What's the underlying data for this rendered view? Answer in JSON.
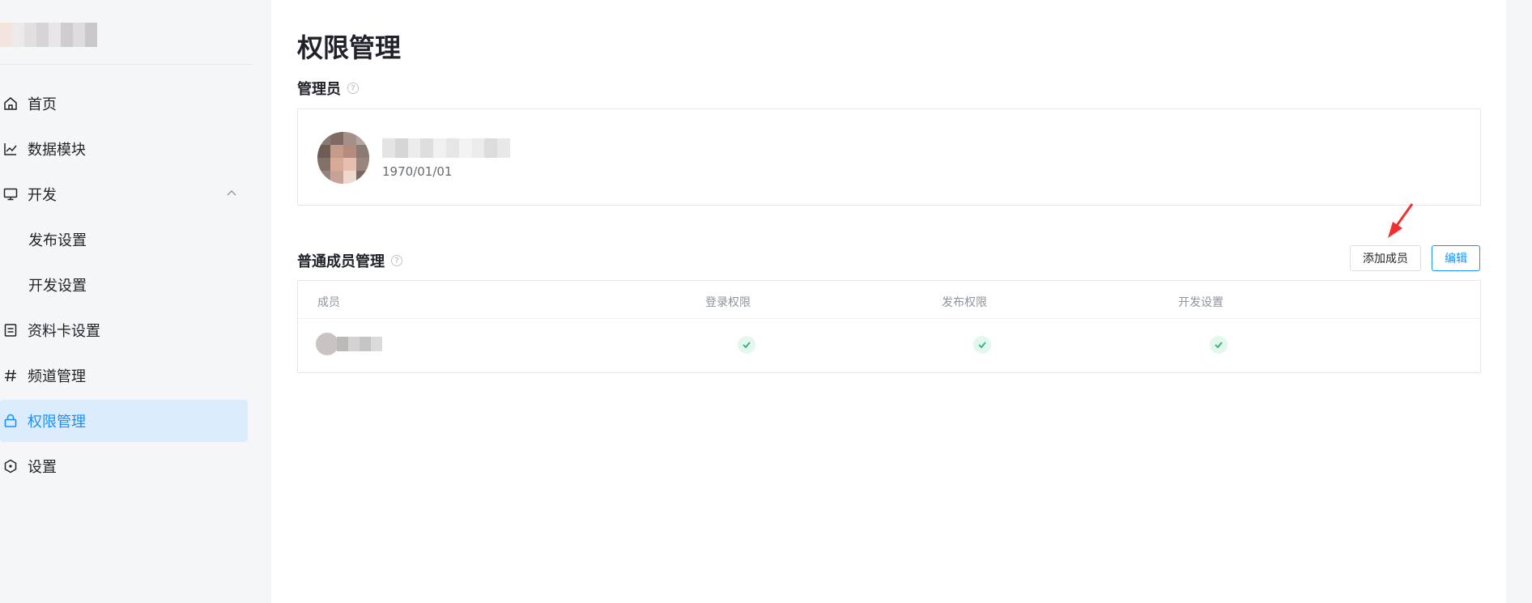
{
  "sidebar": {
    "items": [
      {
        "label": "首页",
        "icon": "home-icon"
      },
      {
        "label": "数据模块",
        "icon": "line-chart-icon"
      },
      {
        "label": "开发",
        "icon": "monitor-icon",
        "expanded": true
      },
      {
        "label": "发布设置",
        "sub": true
      },
      {
        "label": "开发设置",
        "sub": true
      },
      {
        "label": "资料卡设置",
        "icon": "card-icon"
      },
      {
        "label": "频道管理",
        "icon": "hash-icon"
      },
      {
        "label": "权限管理",
        "icon": "lock-icon",
        "active": true
      },
      {
        "label": "设置",
        "icon": "hexagon-icon"
      }
    ]
  },
  "page": {
    "title": "权限管理"
  },
  "admin": {
    "section_title": "管理员",
    "help": "?",
    "date": "1970/01/01"
  },
  "members": {
    "section_title": "普通成员管理",
    "help": "?",
    "add_button": "添加成员",
    "edit_button": "编辑",
    "columns": [
      "成员",
      "登录权限",
      "发布权限",
      "开发设置"
    ],
    "rows": [
      {
        "login": true,
        "publish": true,
        "develop": true
      }
    ]
  },
  "colors": {
    "accent": "#1890ff",
    "active_bg": "#dcecfc",
    "check_green": "#2bb673"
  }
}
